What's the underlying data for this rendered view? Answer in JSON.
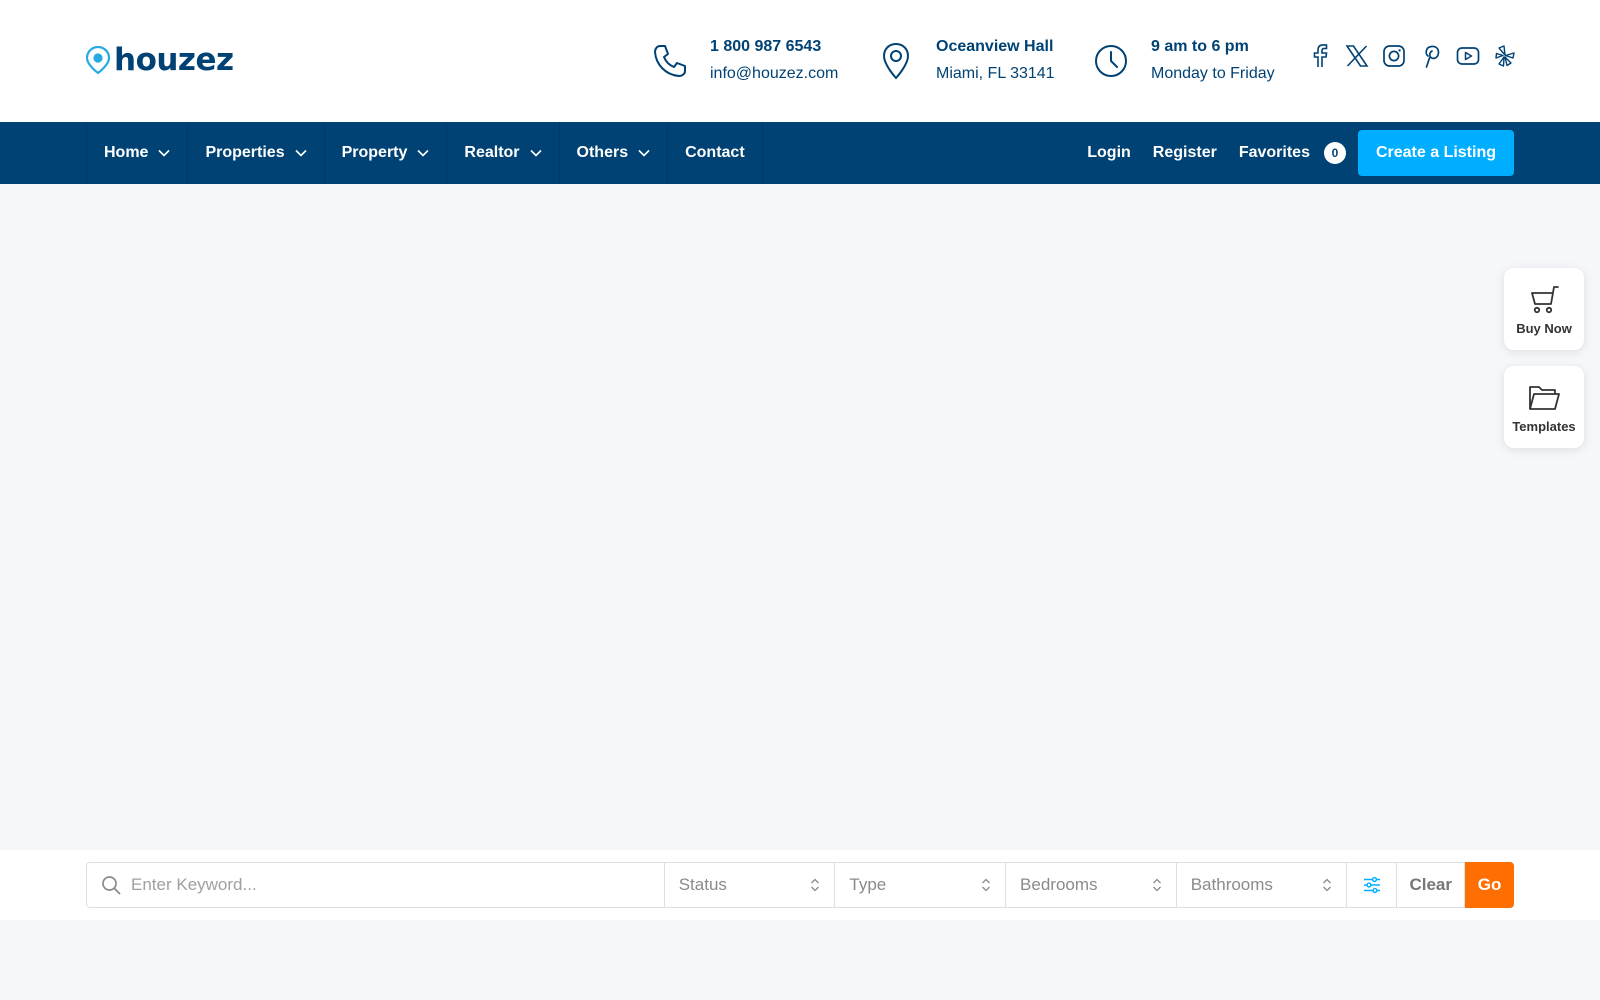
{
  "brand": {
    "name": "houzez",
    "primary_color": "#004274",
    "accent_color": "#00aeff",
    "go_color": "#ff6e00"
  },
  "header": {
    "phone": {
      "icon": "phone-icon",
      "line1": "1 800 987 6543",
      "line2": "info@houzez.com"
    },
    "address": {
      "icon": "map-pin-icon",
      "line1": "Oceanview Hall",
      "line2": "Miami, FL 33141"
    },
    "hours": {
      "icon": "clock-icon",
      "line1": "9 am to 6 pm",
      "line2": "Monday to Friday"
    },
    "social": [
      "facebook-icon",
      "x-twitter-icon",
      "instagram-icon",
      "pinterest-icon",
      "youtube-icon",
      "yelp-icon"
    ]
  },
  "nav": {
    "items": [
      {
        "label": "Home",
        "dropdown": true
      },
      {
        "label": "Properties",
        "dropdown": true
      },
      {
        "label": "Property",
        "dropdown": true
      },
      {
        "label": "Realtor",
        "dropdown": true
      },
      {
        "label": "Others",
        "dropdown": true
      },
      {
        "label": "Contact",
        "dropdown": false
      }
    ],
    "login": "Login",
    "register": "Register",
    "favorites": "Favorites",
    "favorites_count": "0",
    "create_listing": "Create a Listing"
  },
  "side_buttons": {
    "buy_now": {
      "label": "Buy Now",
      "icon": "cart-icon"
    },
    "templates": {
      "label": "Templates",
      "icon": "folder-icon"
    }
  },
  "search": {
    "keyword_placeholder": "Enter Keyword...",
    "status": "Status",
    "type": "Type",
    "bedrooms": "Bedrooms",
    "bathrooms": "Bathrooms",
    "clear": "Clear",
    "go": "Go"
  }
}
